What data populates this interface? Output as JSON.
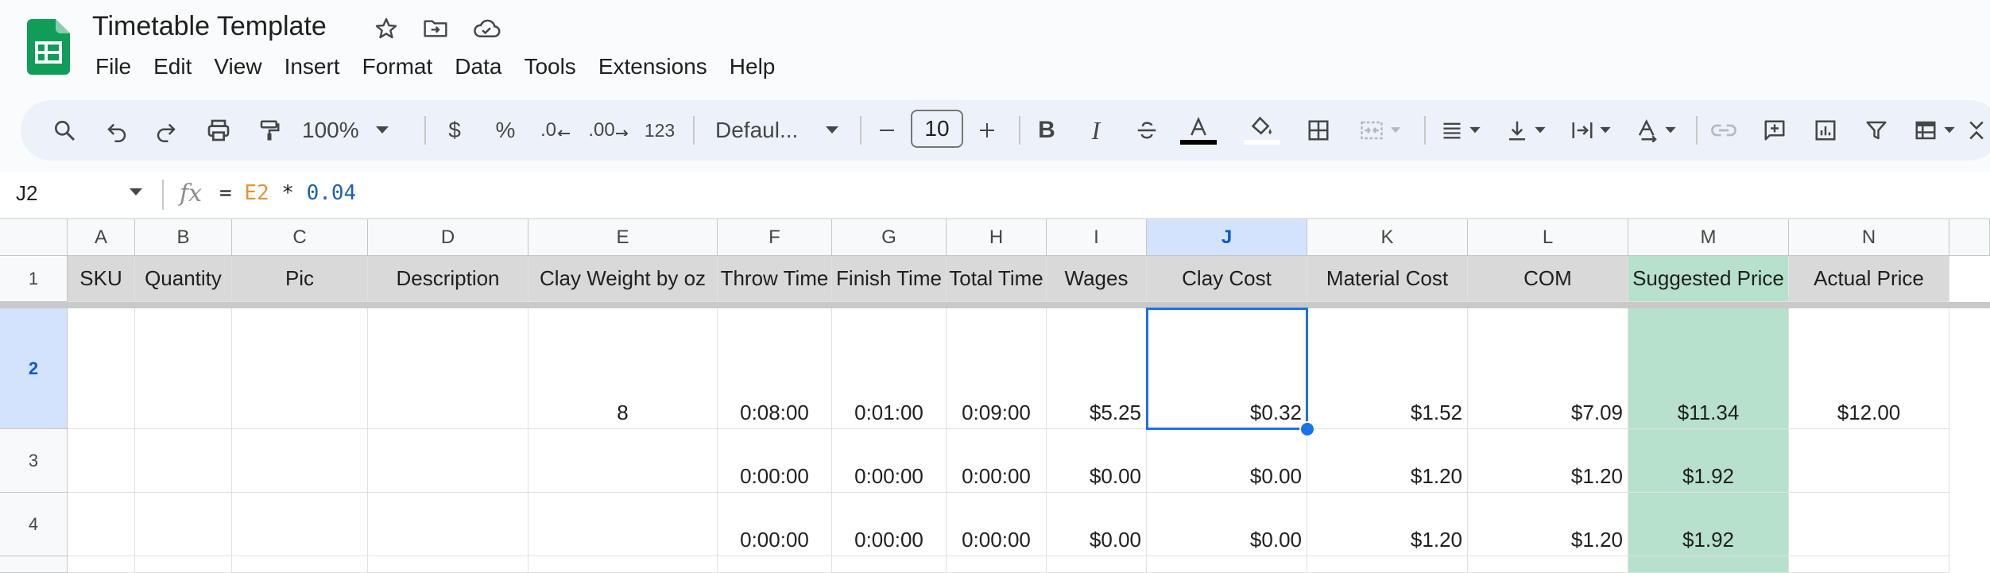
{
  "app": {
    "title": "Timetable Template",
    "menu": [
      "File",
      "Edit",
      "View",
      "Insert",
      "Format",
      "Data",
      "Tools",
      "Extensions",
      "Help"
    ]
  },
  "toolbar": {
    "zoom": "100%",
    "currency": "$",
    "percent": "%",
    "decrease_decimal": ".0",
    "increase_decimal": ".00",
    "number_format": "123",
    "font": "Defaul...",
    "font_size": "10",
    "icons": [
      "search-icon",
      "undo-icon",
      "redo-icon",
      "print-icon",
      "paint-format-icon",
      "bold-icon",
      "italic-icon",
      "strikethrough-icon",
      "text-color-icon",
      "fill-color-icon",
      "borders-icon",
      "merge-cells-icon",
      "align-icon",
      "vertical-align-icon",
      "text-wrap-icon",
      "text-rotate-icon",
      "link-icon",
      "comment-icon",
      "chart-icon",
      "filter-icon",
      "table-icon"
    ]
  },
  "formula_bar": {
    "cell_ref": "J2",
    "fx": "fx",
    "eq": "=",
    "ref": "E2",
    "op": "*",
    "num": "0.04"
  },
  "colors": {
    "header_fill": "#d9d9d9",
    "suggested_price_fill": "#b7e1cd",
    "selection": "#1a73e8",
    "selected_header": "#d3e3fd"
  },
  "grid": {
    "columns": [
      "A",
      "B",
      "C",
      "D",
      "E",
      "F",
      "G",
      "H",
      "I",
      "J",
      "K",
      "L",
      "M",
      "N"
    ],
    "selected_column": "J",
    "selected_cell": "J2",
    "row_numbers": [
      "1",
      "2",
      "3",
      "4"
    ],
    "headers": [
      "SKU",
      "Quantity",
      "Pic",
      "Description",
      "Clay Weight by oz",
      "Throw Time",
      "Finish Time",
      "Total Time",
      "Wages",
      "Clay Cost",
      "Material Cost",
      "COM",
      "Suggested Price",
      "Actual Price"
    ],
    "rows": [
      [
        "",
        "",
        "",
        "",
        "8",
        "0:08:00",
        "0:01:00",
        "0:09:00",
        "$5.25",
        "$0.32",
        "$1.52",
        "$7.09",
        "$11.34",
        "$12.00"
      ],
      [
        "",
        "",
        "",
        "",
        "",
        "0:00:00",
        "0:00:00",
        "0:00:00",
        "$0.00",
        "$0.00",
        "$1.20",
        "$1.20",
        "$1.92",
        ""
      ],
      [
        "",
        "",
        "",
        "",
        "",
        "0:00:00",
        "0:00:00",
        "0:00:00",
        "$0.00",
        "$0.00",
        "$1.20",
        "$1.20",
        "$1.92",
        ""
      ]
    ]
  }
}
